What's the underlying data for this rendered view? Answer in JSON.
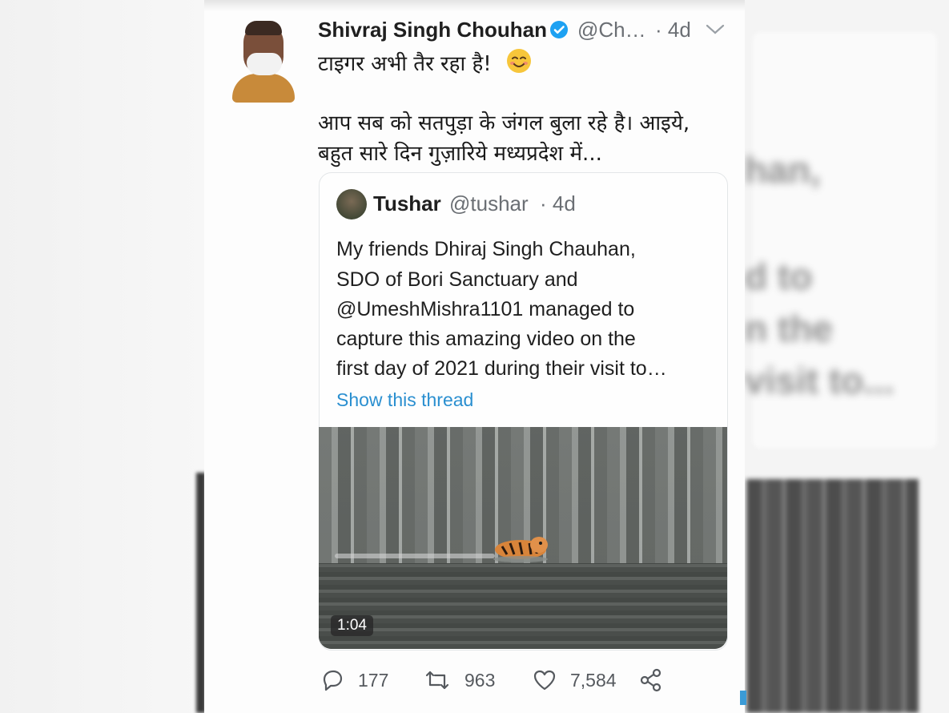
{
  "tweet": {
    "author_name": "Shivraj Singh Chouhan",
    "handle": "@Ch…",
    "time": "· 4d",
    "text_line1": "टाइगर अभी तैर रहा है!",
    "emoji_icon": "smiling-face-emoji",
    "text_line2": "आप सब को सतपुड़ा के जंगल बुला रहे है। आइये,",
    "text_line3": "बहुत सारे दिन गुज़ारिये मध्यप्रदेश में...",
    "menu_icon": "chevron-down-icon",
    "verified_icon": "verified-badge-icon"
  },
  "quoted_tweet": {
    "author_name": "Tushar",
    "handle": "@tushar",
    "time": "· 4d",
    "lines": [
      "My friends Dhiraj Singh Chauhan,",
      "SDO of Bori Sanctuary and",
      "@UmeshMishra1101 managed to",
      "capture this amazing video on the",
      "first day of 2021 during their visit to…"
    ],
    "show_thread": "Show this thread",
    "video_duration": "1:04"
  },
  "actions": {
    "replies": "177",
    "retweets": "963",
    "likes": "7,584",
    "icons": [
      "reply-icon",
      "retweet-icon",
      "like-icon",
      "share-icon"
    ]
  },
  "colors": {
    "link": "#2a8fd0",
    "verified": "#1da1f2",
    "muted": "#6b6f74"
  }
}
